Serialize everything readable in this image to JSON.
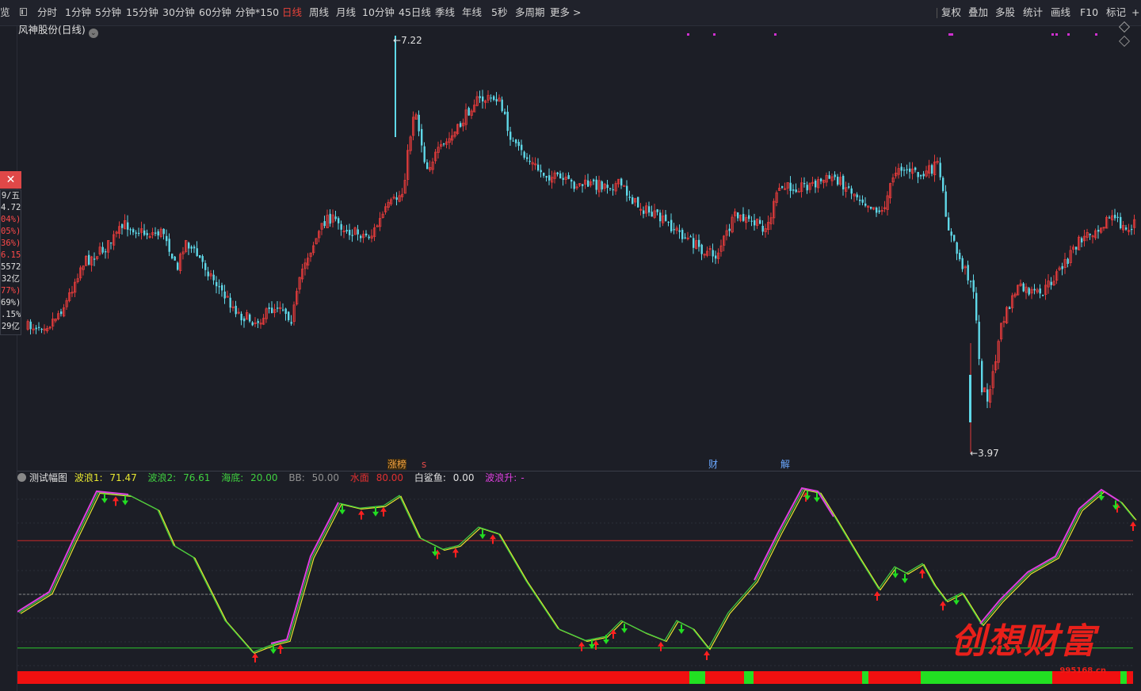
{
  "toolbar": {
    "left_glyph": "览",
    "periods": [
      "分时",
      "1分钟",
      "5分钟",
      "15分钟",
      "30分钟",
      "60分钟",
      "分钟*150",
      "日线",
      "周线",
      "月线",
      "10分钟",
      "45日线",
      "季线",
      "年线",
      "5秒",
      "多周期",
      "更多 >"
    ],
    "active_period": "日线",
    "tools": [
      "复权",
      "叠加",
      "多股",
      "统计",
      "画线",
      "F10",
      "标记",
      "+自"
    ]
  },
  "stock": {
    "title": "风神股份(日线)",
    "high_label": "7.22",
    "low_label": "3.97"
  },
  "quote_panel": {
    "close_symbol": "✕",
    "rows": [
      {
        "text": "9/五",
        "color": "white"
      },
      {
        "text": "4.72",
        "color": "white"
      },
      {
        "text": "04%)",
        "color": "red"
      },
      {
        "text": "05%)",
        "color": "red"
      },
      {
        "text": "36%)",
        "color": "red"
      },
      {
        "text": "6.15",
        "color": "red"
      },
      {
        "text": "5572",
        "color": "white"
      },
      {
        "text": "32亿",
        "color": "white"
      },
      {
        "text": "77%)",
        "color": "red"
      },
      {
        "text": "69%)",
        "color": "white"
      },
      {
        "text": ".15%",
        "color": "white"
      },
      {
        "text": "29亿",
        "color": "white"
      }
    ]
  },
  "event_tags": [
    {
      "text": "涨榜",
      "color": "#f0a040"
    },
    {
      "text": "s",
      "color": "#e04848"
    },
    {
      "text": "财",
      "color": "#6aa8ff"
    },
    {
      "text": "解",
      "color": "#6aa8ff"
    }
  ],
  "indicator": {
    "name": "测试幅图",
    "values": [
      {
        "label": "波浪1:",
        "value": "71.47",
        "color": "#e8e830"
      },
      {
        "label": "波浪2:",
        "value": "76.61",
        "color": "#40d040"
      },
      {
        "label": "海底:",
        "value": "20.00",
        "color": "#40d040"
      },
      {
        "label": "BB:",
        "value": "50.00",
        "color": "#909090"
      },
      {
        "label": "水面",
        "value": "80.00",
        "color": "#e03030"
      },
      {
        "label": "白鲨鱼:",
        "value": "0.00",
        "color": "#e0e0e0"
      },
      {
        "label": "波浪升:",
        "value": "-",
        "color": "#e040e0"
      }
    ],
    "levels": {
      "water": 80,
      "mid": 50,
      "sea_floor": 20
    }
  },
  "watermark": {
    "text": "创想财富",
    "url": "995168.cn"
  },
  "colors": {
    "up": "#e23b3b",
    "down": "#5fd8e8",
    "wave1": "#e8e830",
    "wave2": "#40d040",
    "wave_up": "#e040e0"
  }
}
